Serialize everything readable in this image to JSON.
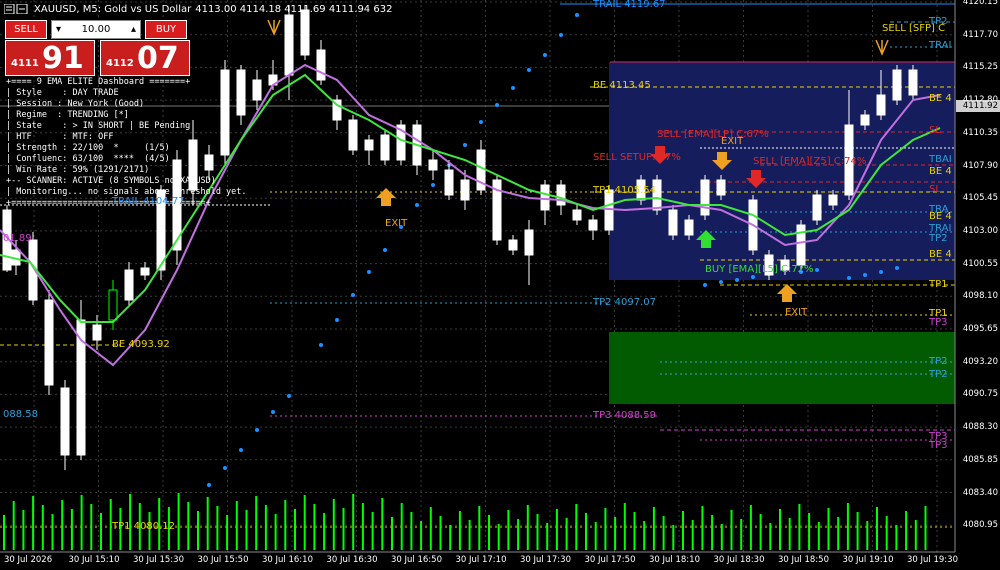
{
  "title": {
    "symbol_text": "XAUUSD, M5:  Gold vs US Dollar",
    "ohlc_text": "4113.00 4114.18 4111.69 4111.94  632"
  },
  "trade_panel": {
    "sell_label": "SELL",
    "buy_label": "BUY",
    "volume": "10.00",
    "sell_prefix": "4111",
    "sell_big": "91",
    "buy_prefix": "4112",
    "buy_big": "07"
  },
  "dashboard": {
    "lines": [
      "+==== 9 EMA ELITE Dashboard =======+",
      "| Style    : DAY TRADE",
      "| Session : New York (Good)",
      "| Regime  : TRENDING [*]",
      "| State    : > IN SHORT | BE Pending",
      "| HTF      : MTF: OFF",
      "| Strength : 22/100  *     (1/5)",
      "| Confluenc: 63/100  ****  (4/5)",
      "| Win Rate : 59% (1291/2171)",
      "+-- SCANNER: ACTIVE (8 SYMBOLS no XAUUSD)",
      "| Monitoring... no signals above threshold yet.",
      "+======================================+"
    ]
  },
  "price_axis": {
    "labels": [
      "4120.15",
      "4117.70",
      "4115.25",
      "4112.80",
      "4110.35",
      "4107.90",
      "4105.45",
      "4103.00",
      "4100.55",
      "4098.10",
      "4095.65",
      "4093.20",
      "4090.75",
      "4088.30",
      "4085.85",
      "4083.40",
      "4080.95"
    ],
    "current_price": "4111.92"
  },
  "time_axis": {
    "labels": [
      "30 Jul 2026",
      "30 Jul 15:10",
      "30 Jul 15:30",
      "30 Jul 15:50",
      "30 Jul 16:10",
      "30 Jul 16:30",
      "30 Jul 16:50",
      "30 Jul 17:10",
      "30 Jul 17:30",
      "30 Jul 17:50",
      "30 Jul 18:10",
      "30 Jul 18:30",
      "30 Jul 18:50",
      "30 Jul 19:10",
      "30 Jul 19:30"
    ]
  },
  "chart_labels": {
    "trail_top": "TRAIL 4119.67",
    "be_top": "BE 4113.45",
    "tp1_mid": "TP1 4105.54",
    "trail_left": "TRAIL 4104.77",
    "tp2_mid": "TP2 4097.07",
    "be_left": "BE 4093.92",
    "tp3_mid": "TP3 4088.59",
    "tp1_bottom": "TP1 4080.12",
    "left_magenta": "01.89",
    "left_cyan": "088.58",
    "sell_setup": "SELL SETUP: 77%",
    "sell_ema1": "SELL [EMA][LP] C:67%",
    "sell_ema2": "SELL [EMA][Z5] C:74%",
    "sell_sfp": "SELL [SFP] C",
    "exit_a": "EXIT",
    "exit_b": "EXIT",
    "exit_c": "EXIT",
    "buy_ema": "BUY [EMA][L5] C:72%",
    "r_tp2a": "TP2",
    "r_trai1": "TRAI",
    "r_be1": "BE 4",
    "r_sl1": "SL",
    "r_tbai": "TBAI",
    "r_be2": "BE 4",
    "r_sl2": "SL",
    "r_tra2": "TRA",
    "r_be3": "BE 4",
    "r_tra3": "TRAI",
    "r_tp2b": "TP2",
    "r_be4": "BE 4",
    "r_tp1a": "TP1",
    "r_tp1b": "TP1",
    "r_tp3a": "TP3",
    "r_tp2c": "TP2",
    "r_tp2d": "TP2",
    "r_tp3b": "TP3",
    "r_tp3c": "TP3",
    "r_be5": "BE 4",
    "r_sl3": "SL"
  },
  "colors": {
    "bull": "#00ff00",
    "bear": "#ffffff",
    "ema_fast": "#3ee63e",
    "ema_slow": "#c070e0",
    "grid": "#3a3a3a",
    "box_blue": "#161d5c",
    "box_green": "#025b00",
    "trail": "#1e90ff",
    "be": "#e8d200",
    "tp": "#2aa0d6",
    "tp3": "#d040d0",
    "sell": "#e02828",
    "exit": "#f0a020",
    "buy": "#30e030"
  }
}
